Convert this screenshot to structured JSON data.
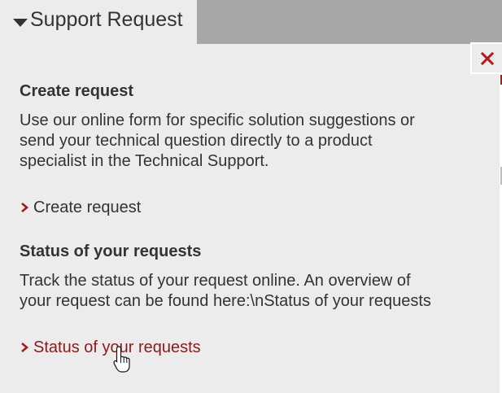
{
  "tab": {
    "label": "Support Request",
    "caret_icon": "caret-down-icon"
  },
  "close": {
    "icon": "close-icon",
    "color": "#b31b1b"
  },
  "sections": [
    {
      "heading": "Create request",
      "description": "Use our online form for specific solution suggestions or\nsend your technical question directly to a product\nspecialist in the Technical Support.",
      "link_label": "Create request"
    },
    {
      "heading": "Status of your requests",
      "description": "Track the status of your request online. An overview of\nyour request can be found here:\\nStatus of your requests",
      "link_label": "Status of your requests"
    }
  ],
  "colors": {
    "accent": "#a61c1c",
    "link_hover": "#8c1a1a",
    "text": "#333333",
    "panel_bg": "#ececec",
    "tab_bar_bg": "#a8a8a8"
  }
}
